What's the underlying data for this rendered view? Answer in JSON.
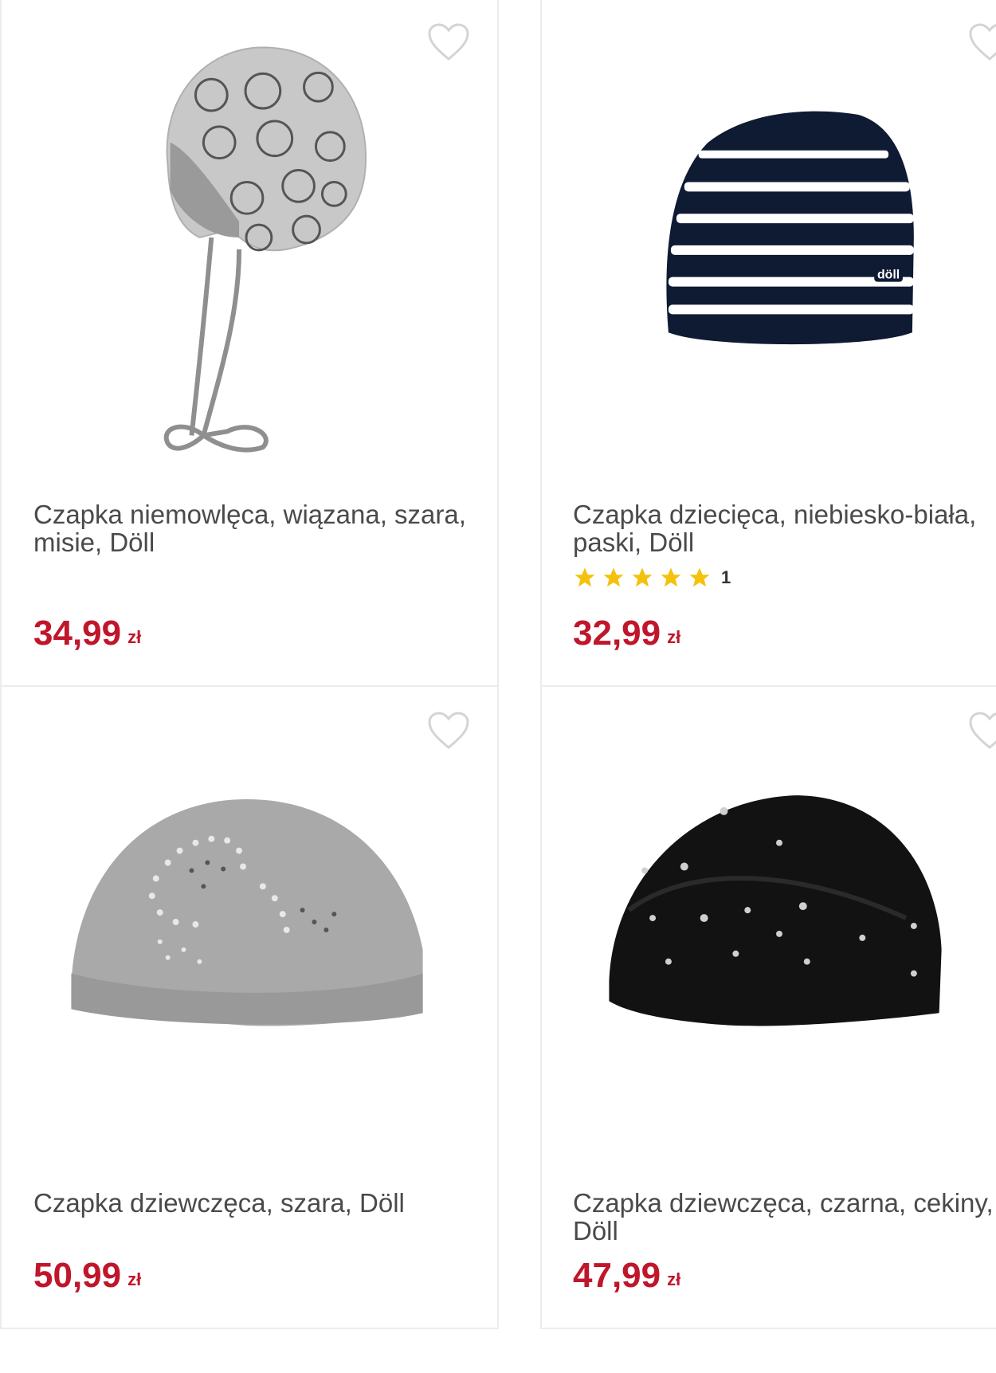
{
  "products": [
    {
      "title": "Czapka niemowlęca, wiązana, szara, misie, Döll",
      "price": "34,99",
      "currency": "zł",
      "image_icon": "grey-baby-hat-with-bears-image"
    },
    {
      "title": "Czapka dziecięca, niebiesko-biała, paski, Döll",
      "price": "32,99",
      "currency": "zł",
      "rating_count": "1",
      "rating_stars": 5,
      "image_icon": "navy-white-striped-hat-image",
      "image_logo": "döll"
    },
    {
      "title": "Czapka dziewczęca, szara, Döll",
      "price": "50,99",
      "currency": "zł",
      "image_icon": "grey-rhinestone-beanie-image"
    },
    {
      "title": "Czapka dziewczęca, czarna, cekiny, Döll",
      "price": "47,99",
      "currency": "zł",
      "image_icon": "black-sequin-beanie-image"
    }
  ],
  "colors": {
    "price": "#c0162b",
    "star": "#f4c20d",
    "heart": "#d4d4d4",
    "border": "#ececec"
  }
}
